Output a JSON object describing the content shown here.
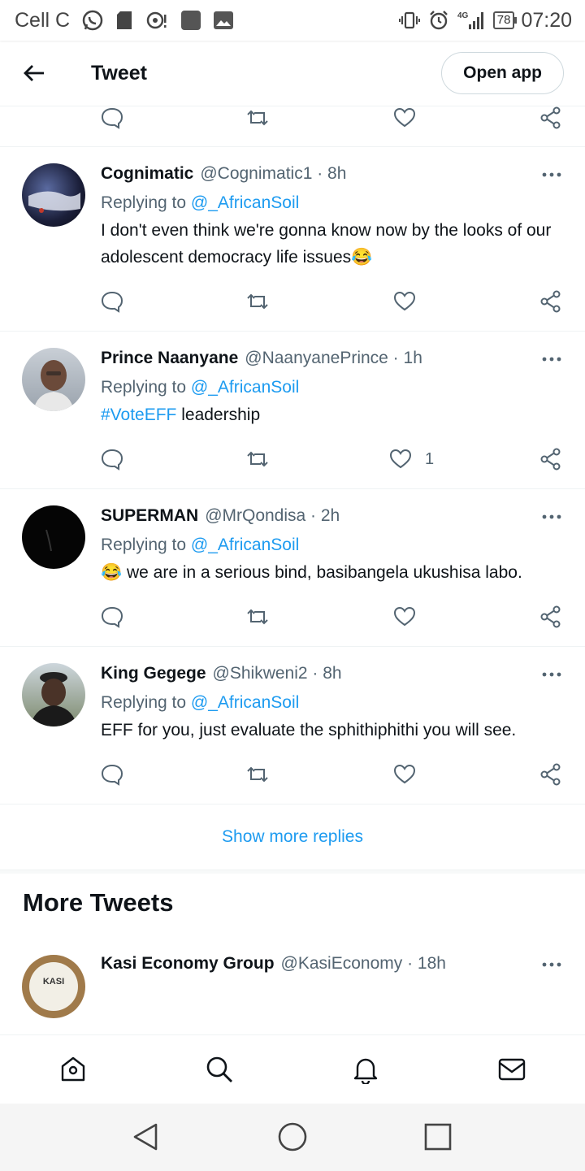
{
  "status_bar": {
    "carrier": "Cell C",
    "network": "4G",
    "battery": "78",
    "time": "07:20"
  },
  "app_bar": {
    "title": "Tweet",
    "open_app_label": "Open app"
  },
  "replies": [
    {
      "name": "Cognimatic",
      "handle": "@Cognimatic1 · 8h",
      "replying_prefix": "Replying to",
      "replying_to": "@_AfricanSoil",
      "text": "I don't even think we're gonna know now by the looks of our adolescent democracy life issues😂",
      "likes": "",
      "avatar_color": "#1b1f3a"
    },
    {
      "name": "Prince Naanyane",
      "handle": "@NaanyanePrince · 1h",
      "replying_prefix": "Replying to",
      "replying_to": "@_AfricanSoil",
      "hashtag": "#VoteEFF",
      "text": " leadership",
      "likes": "1",
      "avatar_color": "#6b4a3a"
    },
    {
      "name": "SUPERMAN",
      "handle": "@MrQondisa · 2h",
      "replying_prefix": "Replying to",
      "replying_to": "@_AfricanSoil",
      "text": "😂 we are in a serious bind, basibangela ukushisa labo.",
      "likes": "",
      "avatar_color": "#050505"
    },
    {
      "name": "King Gegege",
      "handle": "@Shikweni2 · 8h",
      "replying_prefix": "Replying to",
      "replying_to": "@_AfricanSoil",
      "text": "EFF for you, just evaluate the sphithiphithi you will see.",
      "likes": "",
      "avatar_color": "#3b3b3b"
    }
  ],
  "show_more_label": "Show more replies",
  "more_tweets": {
    "heading": "More Tweets",
    "first": {
      "name": "Kasi Economy Group",
      "handle": "@KasiEconomy · 18h",
      "avatar_text": "KASI",
      "avatar_color": "#a07a4a"
    }
  },
  "colors": {
    "link": "#1d9bf0",
    "secondary": "#536471",
    "text": "#0f1419"
  }
}
